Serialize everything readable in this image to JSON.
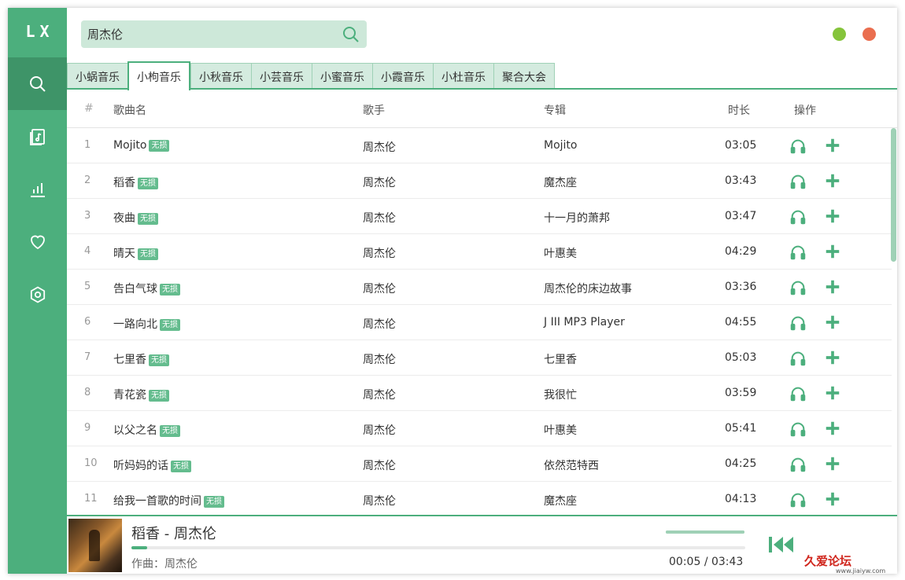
{
  "app": {
    "logo": "LX"
  },
  "sidebar": {
    "items": [
      {
        "icon": "search-icon"
      },
      {
        "icon": "music-list-icon"
      },
      {
        "icon": "chart-icon"
      },
      {
        "icon": "heart-icon"
      },
      {
        "icon": "settings-icon"
      }
    ]
  },
  "search": {
    "value": "周杰伦"
  },
  "tabs": [
    "小蜗音乐",
    "小枸音乐",
    "小秋音乐",
    "小芸音乐",
    "小蜜音乐",
    "小霞音乐",
    "小杜音乐",
    "聚合大会"
  ],
  "table": {
    "headers": {
      "num": "#",
      "name": "歌曲名",
      "artist": "歌手",
      "album": "专辑",
      "duration": "时长",
      "actions": "操作"
    },
    "badge": "无损",
    "rows": [
      {
        "num": "1",
        "name": "Mojito",
        "artist": "周杰伦",
        "album": "Mojito",
        "duration": "03:05"
      },
      {
        "num": "2",
        "name": "稻香",
        "artist": "周杰伦",
        "album": "魔杰座",
        "duration": "03:43"
      },
      {
        "num": "3",
        "name": "夜曲",
        "artist": "周杰伦",
        "album": "十一月的萧邦",
        "duration": "03:47"
      },
      {
        "num": "4",
        "name": "晴天",
        "artist": "周杰伦",
        "album": "叶惠美",
        "duration": "04:29"
      },
      {
        "num": "5",
        "name": "告白气球",
        "artist": "周杰伦",
        "album": "周杰伦的床边故事",
        "duration": "03:36"
      },
      {
        "num": "6",
        "name": "一路向北",
        "artist": "周杰伦",
        "album": "J III MP3 Player",
        "duration": "04:55"
      },
      {
        "num": "7",
        "name": "七里香",
        "artist": "周杰伦",
        "album": "七里香",
        "duration": "05:03"
      },
      {
        "num": "8",
        "name": "青花瓷",
        "artist": "周杰伦",
        "album": "我很忙",
        "duration": "03:59"
      },
      {
        "num": "9",
        "name": "以父之名",
        "artist": "周杰伦",
        "album": "叶惠美",
        "duration": "05:41"
      },
      {
        "num": "10",
        "name": "听妈妈的话",
        "artist": "周杰伦",
        "album": "依然范特西",
        "duration": "04:25"
      },
      {
        "num": "11",
        "name": "给我一首歌的时间",
        "artist": "周杰伦",
        "album": "魔杰座",
        "duration": "04:13"
      }
    ]
  },
  "player": {
    "title": "稻香 - 周杰伦",
    "composer": "作曲：周杰伦",
    "current_time": "00:05",
    "separator": "/",
    "total_time": "03:43",
    "progress": 0.025,
    "volume": 1.0
  },
  "watermark": {
    "text": "久爱论坛",
    "url": "www.jiaiyw.com"
  },
  "colors": {
    "accent": "#4caf7d",
    "accent_dark": "#3e9468",
    "minimize": "#85c43b",
    "close": "#ea6e4f"
  }
}
